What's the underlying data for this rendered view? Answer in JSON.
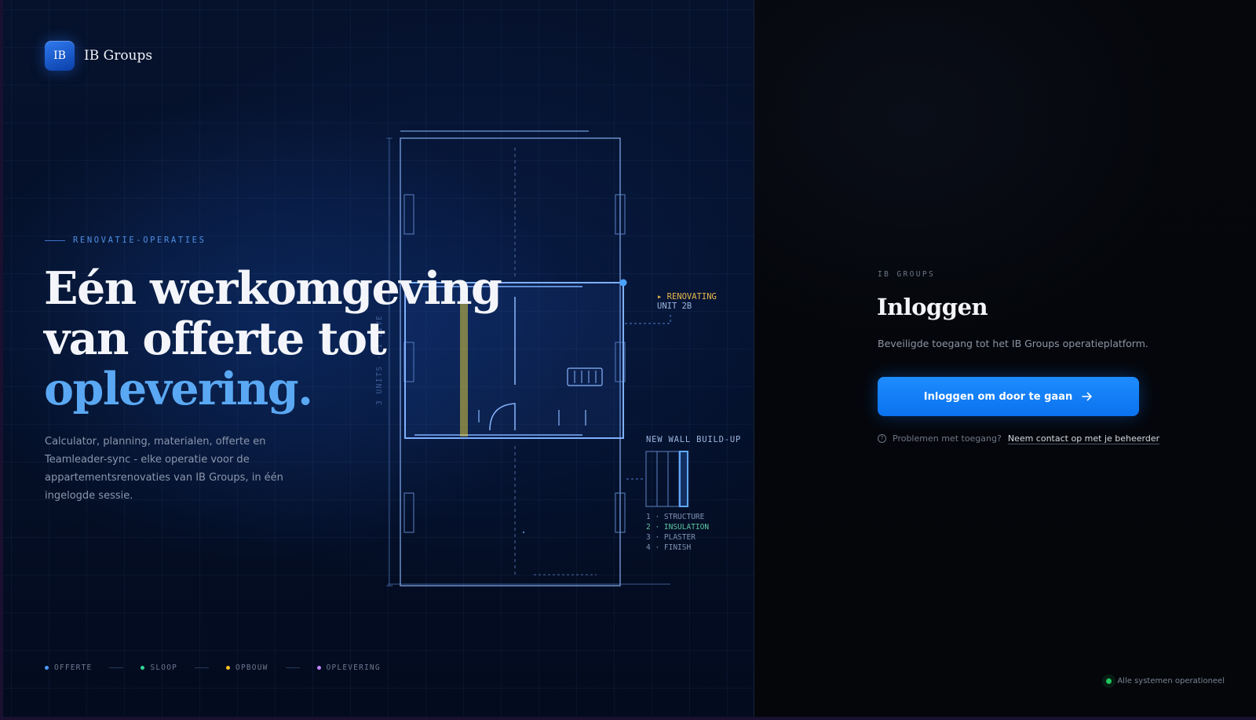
{
  "brand": {
    "logo_text": "IB",
    "name": "IB Groups",
    "accent": "#2f7af0"
  },
  "hero": {
    "eyebrow": "RENOVATIE-OPERATIES",
    "headline_line1": "Eén werkomgeving",
    "headline_line2": "van offerte tot",
    "headline_accent": "oplevering.",
    "description": "Calculator, planning, materialen, offerte en Teamleader-sync - elke operatie voor de appartementsrenovaties van IB Groups, in één ingelogde sessie."
  },
  "phases": [
    {
      "label": "OFFERTE",
      "color": "#4d9bff"
    },
    {
      "label": "SLOOP",
      "color": "#34d399"
    },
    {
      "label": "OPBOUW",
      "color": "#fbbf24"
    },
    {
      "label": "OPLEVERING",
      "color": "#c084fc"
    }
  ],
  "blueprint": {
    "vertical_label": "3 UNITS · 1 LIVE",
    "renovating_label": "▸ RENOVATING",
    "unit_label": "UNIT 2B",
    "buildup_title": "NEW WALL BUILD-UP",
    "layers": [
      "1 · STRUCTURE",
      "2 · INSULATION",
      "3 · PLASTER",
      "4 · FINISH"
    ]
  },
  "login": {
    "kicker": "IB GROUPS",
    "title": "Inloggen",
    "subtitle": "Beveiligde toegang tot het IB Groups operatieplatform.",
    "button_label": "Inloggen om door te gaan",
    "button_icon": "arrow-right-icon",
    "help_text": "Problemen met toegang?",
    "help_link": "Neem contact op met je beheerder",
    "accent": "#1e8cff"
  },
  "status": {
    "text": "Alle systemen operationeel",
    "color": "#22c55e"
  }
}
